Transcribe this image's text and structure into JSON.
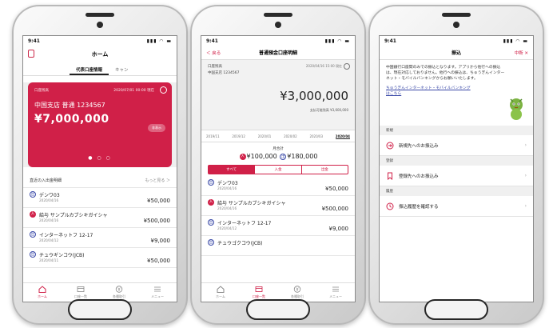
{
  "status": {
    "time": "9:41",
    "icons": "▮▮▮ ◠ ▬"
  },
  "screen1": {
    "title": "ホーム",
    "tabs": [
      "代表口座情報",
      "キャン"
    ],
    "card": {
      "label": "口座残高",
      "timestamp": "2020/07/01 00:00 現在",
      "branch": "中国支店 普通 1234567",
      "amount": "¥7,000,000",
      "hide_label": "非表示"
    },
    "recent": {
      "title": "直近の入出金明細",
      "more": "もっと見る ＞"
    },
    "transactions": [
      {
        "type": "out",
        "badge": "出",
        "name": "デンワ03",
        "date": "2020/04/16",
        "amount": "¥50,000"
      },
      {
        "type": "in",
        "badge": "入",
        "name": "給与 サンプルカブシキガイシャ",
        "date": "2020/04/16",
        "amount": "¥500,000"
      },
      {
        "type": "out",
        "badge": "出",
        "name": "インターネットフ 12-17",
        "date": "2020/04/12",
        "amount": "¥9,000"
      },
      {
        "type": "out",
        "badge": "出",
        "name": "チュウギンコウ(JCB)",
        "date": "2020/04/11",
        "amount": "¥50,000"
      }
    ],
    "nav": [
      "ホーム",
      "口座一覧",
      "各種取引",
      "メニュー"
    ]
  },
  "screen2": {
    "back": "＜ 戻る",
    "title": "普通預金口座明細",
    "acct_label": "口座残高",
    "acct_branch": "中国支店 1234567",
    "stamp": "2020/04/16 15:00 現在",
    "balance": "¥3,000,000",
    "available": "支払可能残高 ¥3,600,000",
    "months": [
      "2019/11",
      "2019/12",
      "2020/01",
      "2020/02",
      "2020/03",
      "2020/04"
    ],
    "summary_label": "月合計",
    "in_badge": "入",
    "in_total": "¥100,000",
    "out_badge": "出",
    "out_total": "¥180,000",
    "segments": [
      "すべて",
      "入金",
      "出金"
    ],
    "transactions": [
      {
        "type": "out",
        "badge": "出",
        "name": "デンワ03",
        "date": "2020/04/16",
        "amount": "¥50,000"
      },
      {
        "type": "in",
        "badge": "入",
        "name": "給与 サンプルカブシキガイシャ",
        "date": "2020/04/16",
        "amount": "¥500,000"
      },
      {
        "type": "out",
        "badge": "出",
        "name": "インターネットフ 12-17",
        "date": "2020/04/12",
        "amount": "¥9,000"
      },
      {
        "type": "out",
        "badge": "出",
        "name": "チュウゴクコウ(JCB)",
        "date": "",
        "amount": ""
      }
    ],
    "nav": [
      "ホーム",
      "口座一覧",
      "各種取引",
      "メニュー"
    ]
  },
  "screen3": {
    "title": "振込",
    "abort": "中断 ✕",
    "intro": "中国銀行口座間のみでの振込となります。アプリから他行への振込は、現在対応しておりません。他行への振込は、ちゅうぎんインターネット・モバイルバンキングからお願いいたします。",
    "link": "ちゅうぎんインターネット・モバイルバンキングはこちら",
    "groups": [
      {
        "label": "新規",
        "item": "新規先へのお振込み"
      },
      {
        "label": "登録",
        "item": "登録先へのお振込み"
      },
      {
        "label": "履歴",
        "item": "振込履歴を確認する"
      }
    ]
  },
  "colors": {
    "brand": "#d02048",
    "out": "#3b4aa8"
  }
}
